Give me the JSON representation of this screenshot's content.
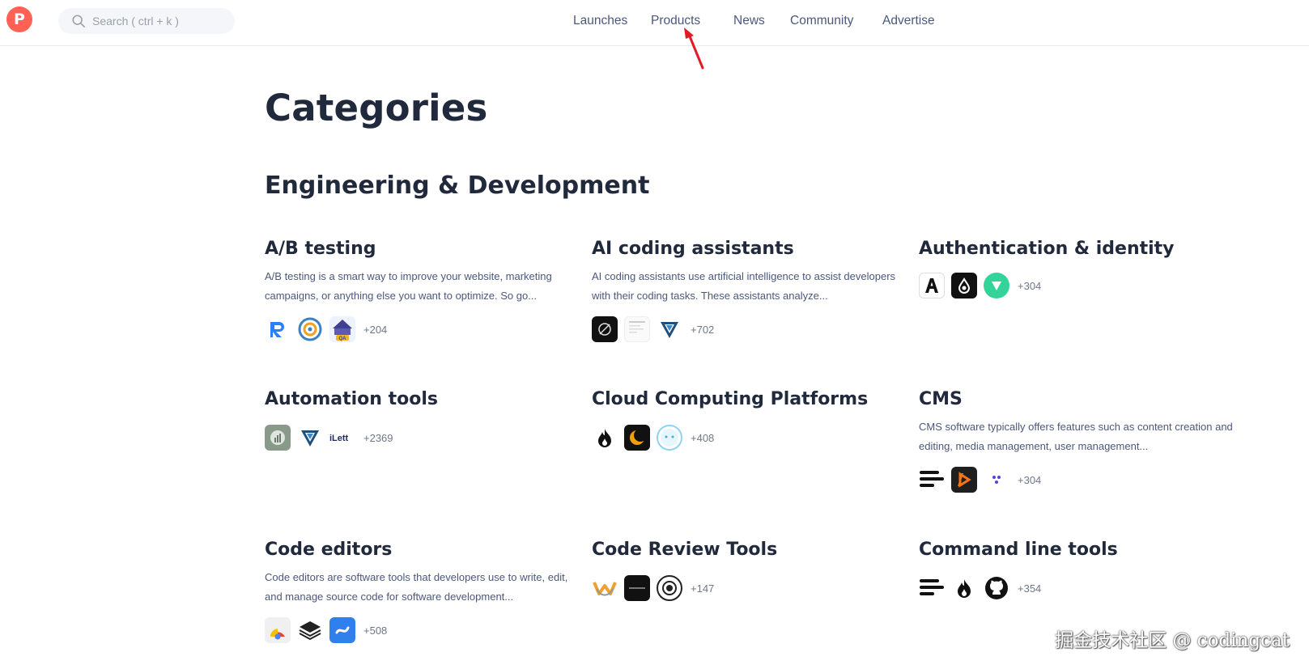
{
  "header": {
    "logo_letter": "P",
    "search_placeholder": "Search ( ctrl + k )",
    "nav": [
      "Launches",
      "Products",
      "News",
      "Community",
      "Advertise"
    ]
  },
  "page": {
    "title": "Categories",
    "section": "Engineering & Development"
  },
  "categories": [
    {
      "title": "A/B testing",
      "description": "A/B testing is a smart way to improve your website, marketing campaigns, or anything else you want to optimize. So go...",
      "count": "+204",
      "logos": [
        "blue-r-logo",
        "target-gear-logo",
        "qa-logo"
      ]
    },
    {
      "title": "AI coding assistants",
      "description": "AI coding assistants use artificial intelligence to assist developers with their coding tasks. These assistants analyze...",
      "count": "+702",
      "logos": [
        "dark-satellite-logo",
        "document-preview-logo",
        "blue-v-shield-logo"
      ]
    },
    {
      "title": "Authentication & identity",
      "description": "",
      "count": "+304",
      "logos": [
        "letter-a-logo",
        "drop-swirl-logo",
        "green-shield-logo"
      ]
    },
    {
      "title": "Automation tools",
      "description": "",
      "count": "+2369",
      "logos": [
        "chart-circle-logo",
        "blue-v-shield-logo",
        "letter-text-logo"
      ]
    },
    {
      "title": "Cloud Computing Platforms",
      "description": "",
      "count": "+408",
      "logos": [
        "flame-logo",
        "moon-logo",
        "face-circle-logo"
      ]
    },
    {
      "title": "CMS",
      "description": "CMS software typically offers features such as content creation and editing, media management, user management...",
      "count": "+304",
      "logos": [
        "bars-logo",
        "orange-play-logo",
        "dots-logo"
      ]
    },
    {
      "title": "Code editors",
      "description": "Code editors are software tools that developers use to write, edit, and manage source code for software development...",
      "count": "+508",
      "logos": [
        "chrome-logo",
        "layers-logo",
        "blue-wave-logo"
      ]
    },
    {
      "title": "Code Review Tools",
      "description": "",
      "count": "+147",
      "logos": [
        "yellow-w-logo",
        "dark-banner-logo",
        "eye-circle-logo"
      ]
    },
    {
      "title": "Command line tools",
      "description": "",
      "count": "+354",
      "logos": [
        "bars-logo",
        "flame-logo",
        "github-logo"
      ]
    }
  ],
  "logo_text": {
    "qa": "QA",
    "automation_letter": "iLett"
  },
  "watermark": "掘金技术社区 @ codingcat",
  "colors": {
    "brand": "#ff6154",
    "title": "#21293c",
    "text": "#4b587c",
    "arrow": "#e01b24"
  }
}
